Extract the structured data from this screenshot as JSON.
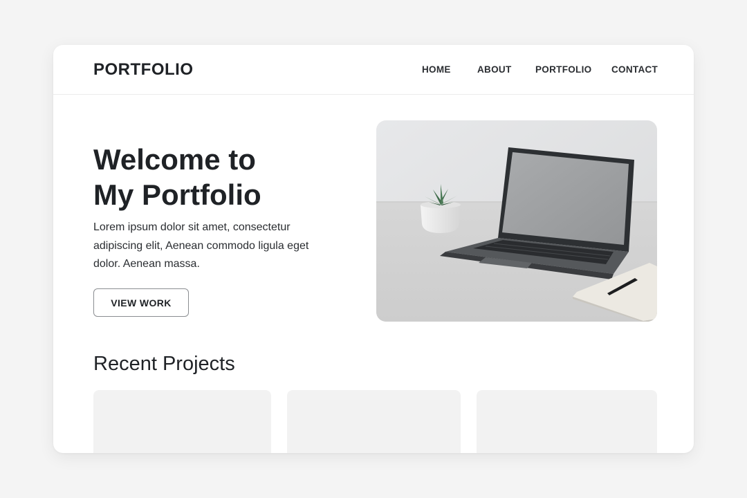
{
  "header": {
    "brand": "PORTFOLIO",
    "nav": [
      {
        "label": "HOME"
      },
      {
        "label": "ABOUT"
      },
      {
        "label": "PORTFOLIO"
      },
      {
        "label": "CONTACT"
      }
    ]
  },
  "hero": {
    "title_line1": "Welcome to",
    "title_line2": "My Portfolio",
    "text": "Lorem ipsum dolor sit amet, consectetur adipiscing elit, Aenean commodo ligula eget dolor. Aenean massa.",
    "cta_label": "VIEW WORK",
    "image_icon": "laptop-workspace-photo"
  },
  "projects": {
    "title": "Recent Projects",
    "cards": [
      {},
      {},
      {}
    ]
  },
  "colors": {
    "background": "#f4f4f4",
    "surface": "#ffffff",
    "text": "#1f2226",
    "card": "#f2f2f2",
    "button_border": "#8a8d91"
  }
}
